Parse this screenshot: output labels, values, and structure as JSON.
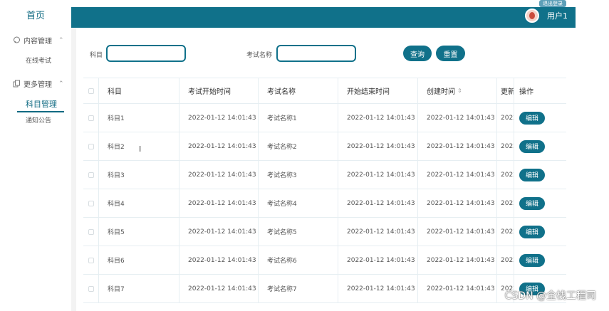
{
  "sidebar": {
    "home": "首页",
    "groups": [
      {
        "label": "内容管理",
        "icon": "chat-bubble-icon",
        "items": [
          "在线考试"
        ]
      },
      {
        "label": "更多管理",
        "icon": "copy-icon",
        "items": [
          "科目管理",
          "通知公告"
        ]
      }
    ],
    "active_item": "科目管理"
  },
  "header": {
    "badge": "退出登录",
    "username": "用户1"
  },
  "search": {
    "subject_label": "科目",
    "subject_value": "",
    "exam_name_label": "考试名称",
    "exam_name_value": "",
    "query_button": "查询",
    "reset_button": "重置"
  },
  "table": {
    "columns": [
      "科目",
      "考试开始时间",
      "考试名称",
      "开始结束时间",
      "创建时间",
      "更新",
      "操作"
    ],
    "edit_label": "编辑",
    "rows": [
      {
        "subject": "科目1",
        "start": "2022-01-12 14:01:43",
        "name": "考试名称1",
        "end": "2022-01-12 14:01:43",
        "created": "2022-01-12 14:01:43",
        "updated": "2022"
      },
      {
        "subject": "科目2",
        "start": "2022-01-12 14:01:43",
        "name": "考试名称2",
        "end": "2022-01-12 14:01:43",
        "created": "2022-01-12 14:01:43",
        "updated": "2022"
      },
      {
        "subject": "科目3",
        "start": "2022-01-12 14:01:43",
        "name": "考试名称3",
        "end": "2022-01-12 14:01:43",
        "created": "2022-01-12 14:01:43",
        "updated": "2022"
      },
      {
        "subject": "科目4",
        "start": "2022-01-12 14:01:43",
        "name": "考试名称4",
        "end": "2022-01-12 14:01:43",
        "created": "2022-01-12 14:01:43",
        "updated": "2022"
      },
      {
        "subject": "科目5",
        "start": "2022-01-12 14:01:43",
        "name": "考试名称5",
        "end": "2022-01-12 14:01:43",
        "created": "2022-01-12 14:01:43",
        "updated": "2022"
      },
      {
        "subject": "科目6",
        "start": "2022-01-12 14:01:43",
        "name": "考试名称6",
        "end": "2022-01-12 14:01:43",
        "created": "2022-01-12 14:01:43",
        "updated": "2022"
      },
      {
        "subject": "科目7",
        "start": "2022-01-12 14:01:43",
        "name": "考试名称7",
        "end": "2022-01-12 14:01:43",
        "created": "2022-01-12 14:01:43",
        "updated": "2022"
      }
    ]
  },
  "watermark": "CSDN @全栈工程司",
  "colors": {
    "primary": "#10718a",
    "border": "#e6eef2"
  }
}
